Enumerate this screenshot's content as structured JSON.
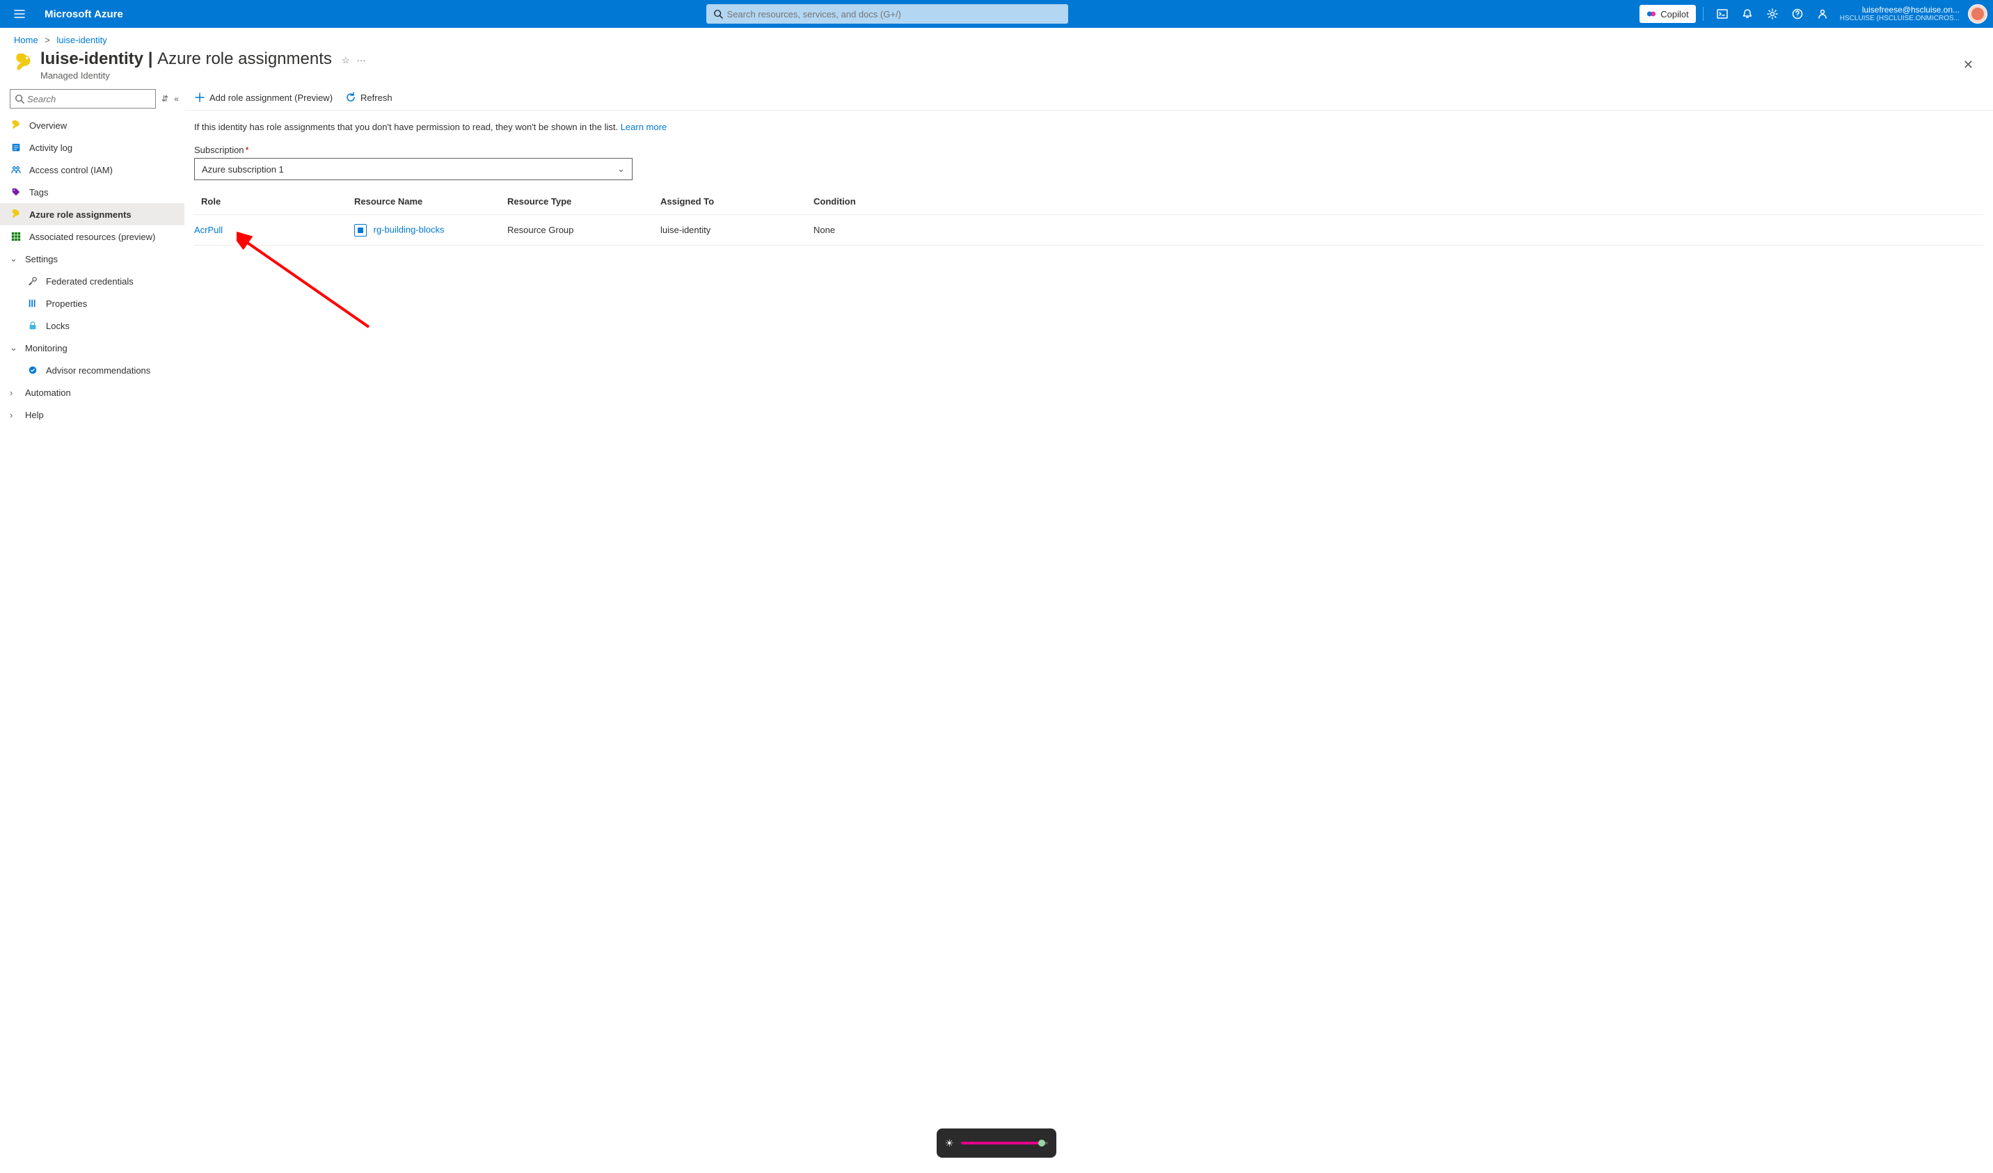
{
  "topbar": {
    "brand": "Microsoft Azure",
    "search_placeholder": "Search resources, services, and docs (G+/)",
    "copilot": "Copilot",
    "account_email": "luisefreese@hscluise.on...",
    "account_tenant": "HSCLUISE (HSCLUISE.ONMICROS..."
  },
  "breadcrumb": {
    "home": "Home",
    "current": "luise-identity"
  },
  "header": {
    "resource_name": "luise-identity",
    "separator": " | ",
    "page_title": "Azure role assignments",
    "subtitle": "Managed Identity",
    "star_glyph": "☆",
    "more_glyph": "···"
  },
  "sidebar": {
    "search_placeholder": "Search",
    "items": [
      {
        "label": "Overview"
      },
      {
        "label": "Activity log"
      },
      {
        "label": "Access control (IAM)"
      },
      {
        "label": "Tags"
      },
      {
        "label": "Azure role assignments",
        "active": true
      },
      {
        "label": "Associated resources (preview)"
      }
    ],
    "settings_label": "Settings",
    "settings_items": [
      {
        "label": "Federated credentials"
      },
      {
        "label": "Properties"
      },
      {
        "label": "Locks"
      }
    ],
    "monitoring_label": "Monitoring",
    "monitoring_items": [
      {
        "label": "Advisor recommendations"
      }
    ],
    "automation_label": "Automation",
    "help_label": "Help"
  },
  "toolbar": {
    "add": "Add role assignment (Preview)",
    "refresh": "Refresh"
  },
  "info": {
    "text": "If this identity has role assignments that you don't have permission to read, they won't be shown in the list. ",
    "learn_more": "Learn more"
  },
  "subscription": {
    "label": "Subscription",
    "value": "Azure subscription 1"
  },
  "table": {
    "columns": [
      "Role",
      "Resource Name",
      "Resource Type",
      "Assigned To",
      "Condition"
    ],
    "rows": [
      {
        "role": "AcrPull",
        "resource_name": "rg-building-blocks",
        "resource_type": "Resource Group",
        "assigned_to": "luise-identity",
        "condition": "None"
      }
    ]
  }
}
